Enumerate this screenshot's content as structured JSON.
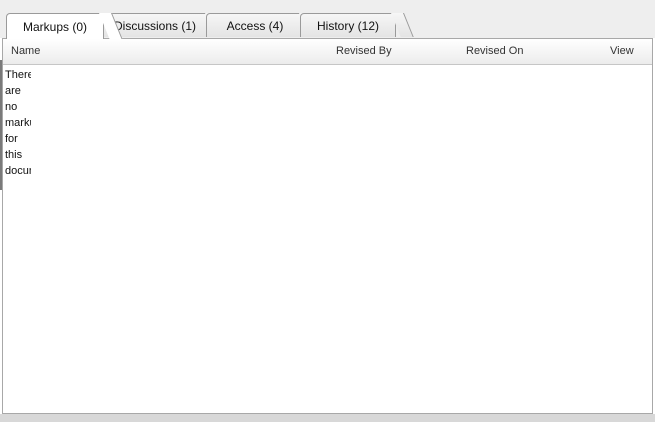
{
  "tabs": [
    {
      "label": "Markups (0)",
      "active": true
    },
    {
      "label": "Discussions (1)",
      "active": false
    },
    {
      "label": "Access (4)",
      "active": false
    },
    {
      "label": "History (12)",
      "active": false
    }
  ],
  "table": {
    "columns": [
      "Name",
      "Revised By",
      "Revised On",
      "View"
    ],
    "empty_message_words": [
      "There",
      "are",
      "no",
      "markups",
      "for",
      "this",
      "document"
    ]
  }
}
